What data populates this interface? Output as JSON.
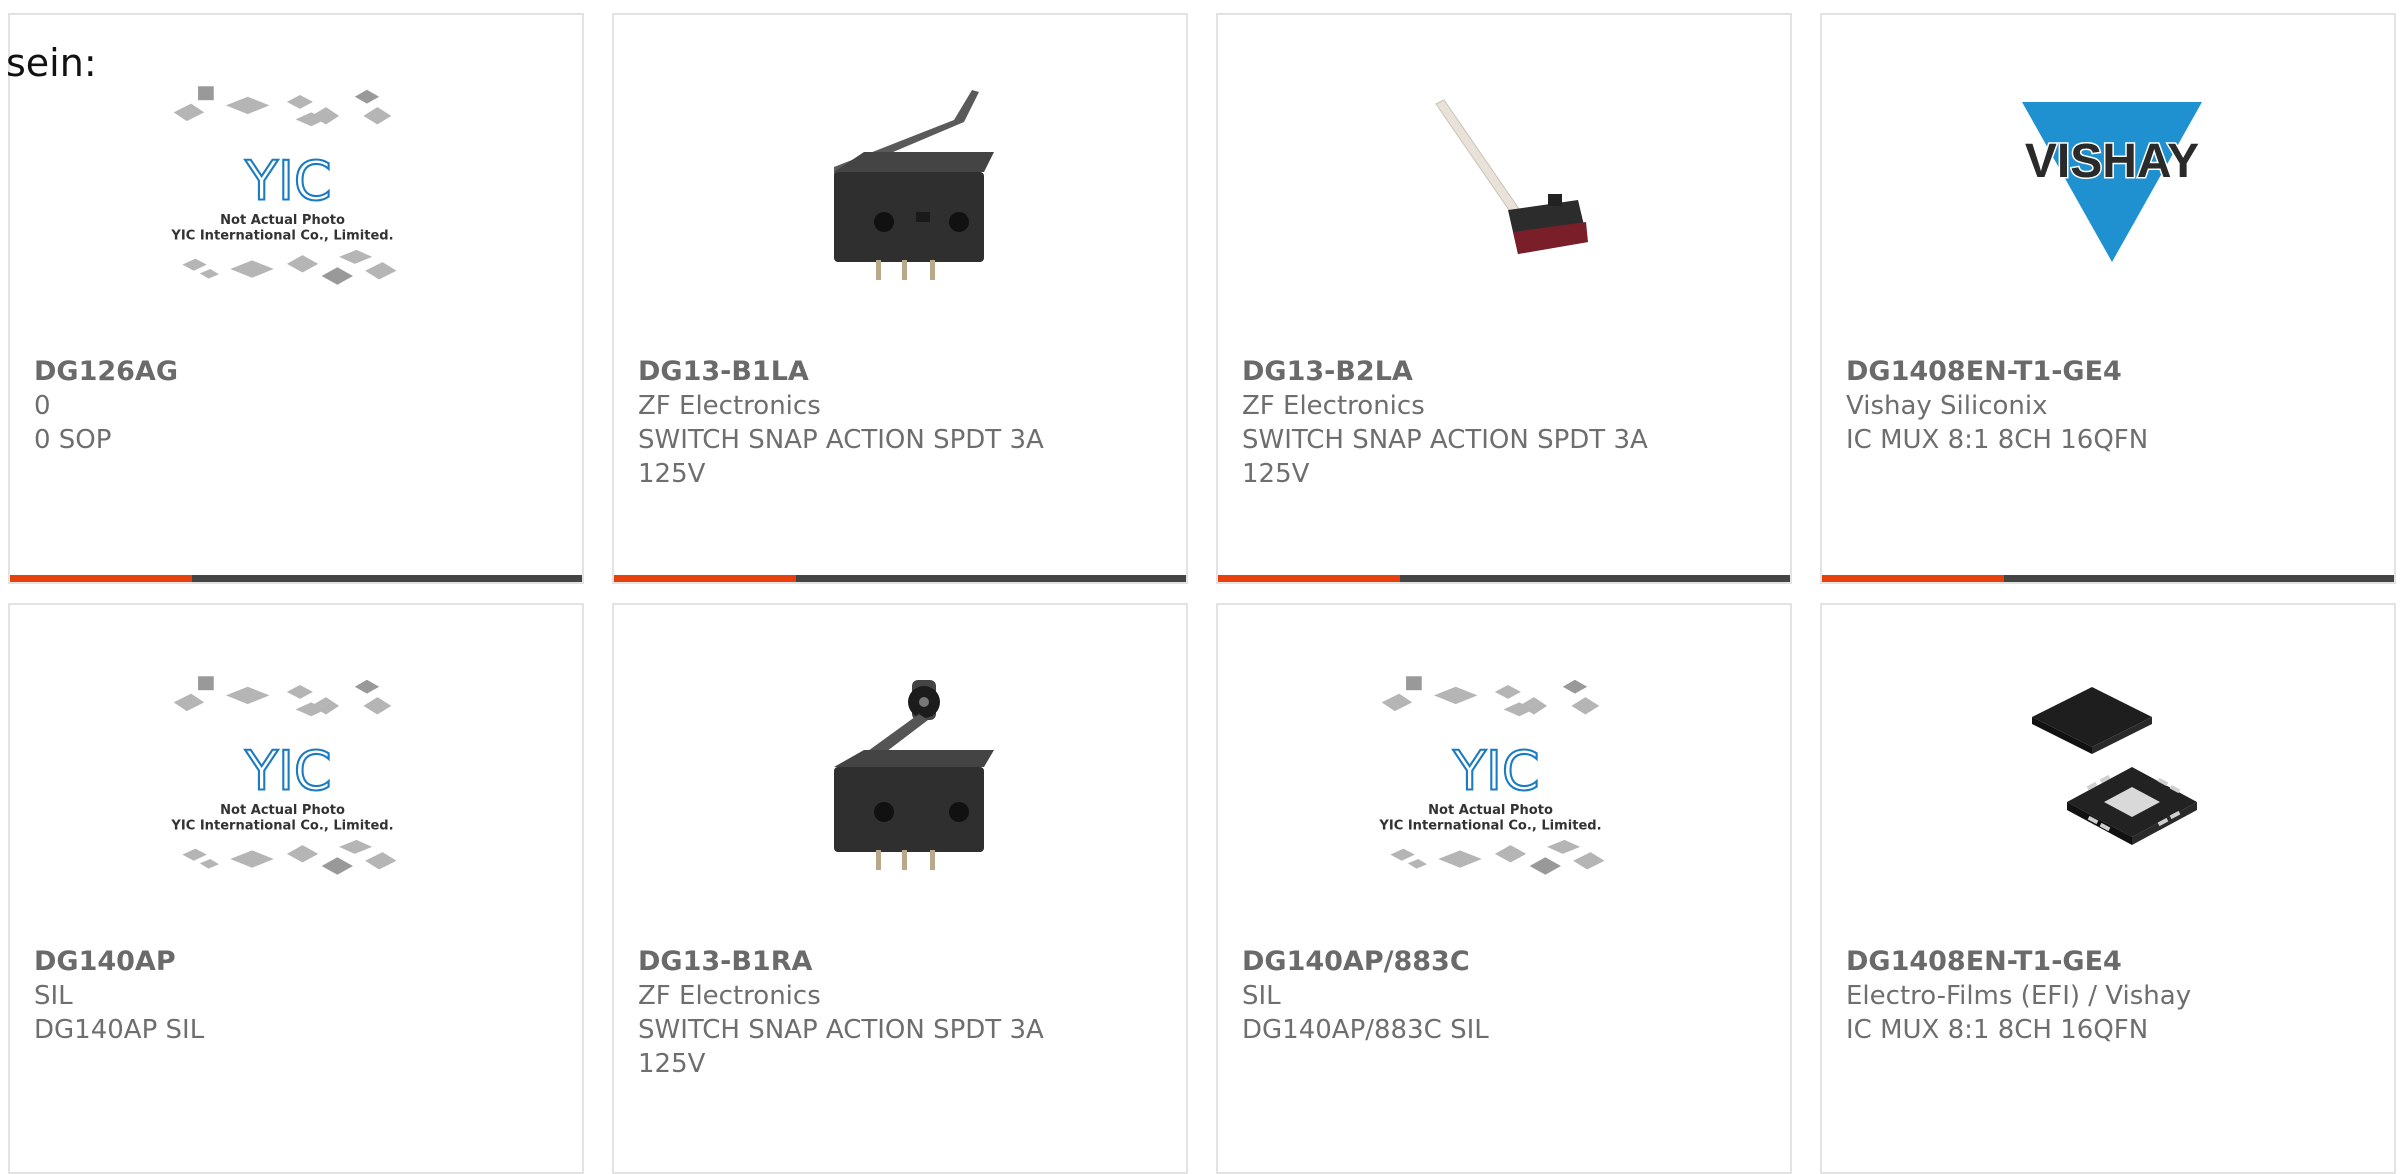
{
  "fragment": "sein:",
  "placeholder_caption": {
    "line1": "Not Actual Photo",
    "line2": "YIC International Co., Limited.",
    "logo": "YIC"
  },
  "brand_logo": "VISHAY",
  "colors": {
    "accent": "#e8400c",
    "bar": "#444444",
    "border": "#e3e3e3",
    "yic_blue": "#1b7bc1",
    "vishay_blue": "#1f91d0"
  },
  "cards": [
    {
      "part": "DG126AG",
      "line1": "0",
      "line2": "0 SOP",
      "image": "placeholder-chips"
    },
    {
      "part": "DG13-B1LA",
      "line1": "ZF Electronics",
      "line2": "SWITCH SNAP ACTION SPDT 3A 125V",
      "image": "microswitch-lever"
    },
    {
      "part": "DG13-B2LA",
      "line1": "ZF Electronics",
      "line2": "SWITCH SNAP ACTION SPDT 3A 125V",
      "image": "microswitch-long-lever"
    },
    {
      "part": "DG1408EN-T1-GE4",
      "line1": "Vishay Siliconix",
      "line2": "IC MUX 8:1 8CH 16QFN",
      "image": "vishay-logo"
    },
    {
      "part": "DG140AP",
      "line1": "SIL",
      "line2": "DG140AP SIL",
      "image": "placeholder-chips"
    },
    {
      "part": "DG13-B1RA",
      "line1": "ZF Electronics",
      "line2": "SWITCH SNAP ACTION SPDT 3A 125V",
      "image": "microswitch-roller"
    },
    {
      "part": "DG140AP/883C",
      "line1": "SIL",
      "line2": "DG140AP/883C SIL",
      "image": "placeholder-chips"
    },
    {
      "part": "DG1408EN-T1-GE4",
      "line1": "Electro-Films (EFI) / Vishay",
      "line2": "IC MUX 8:1 8CH 16QFN",
      "image": "qfn-package"
    }
  ]
}
